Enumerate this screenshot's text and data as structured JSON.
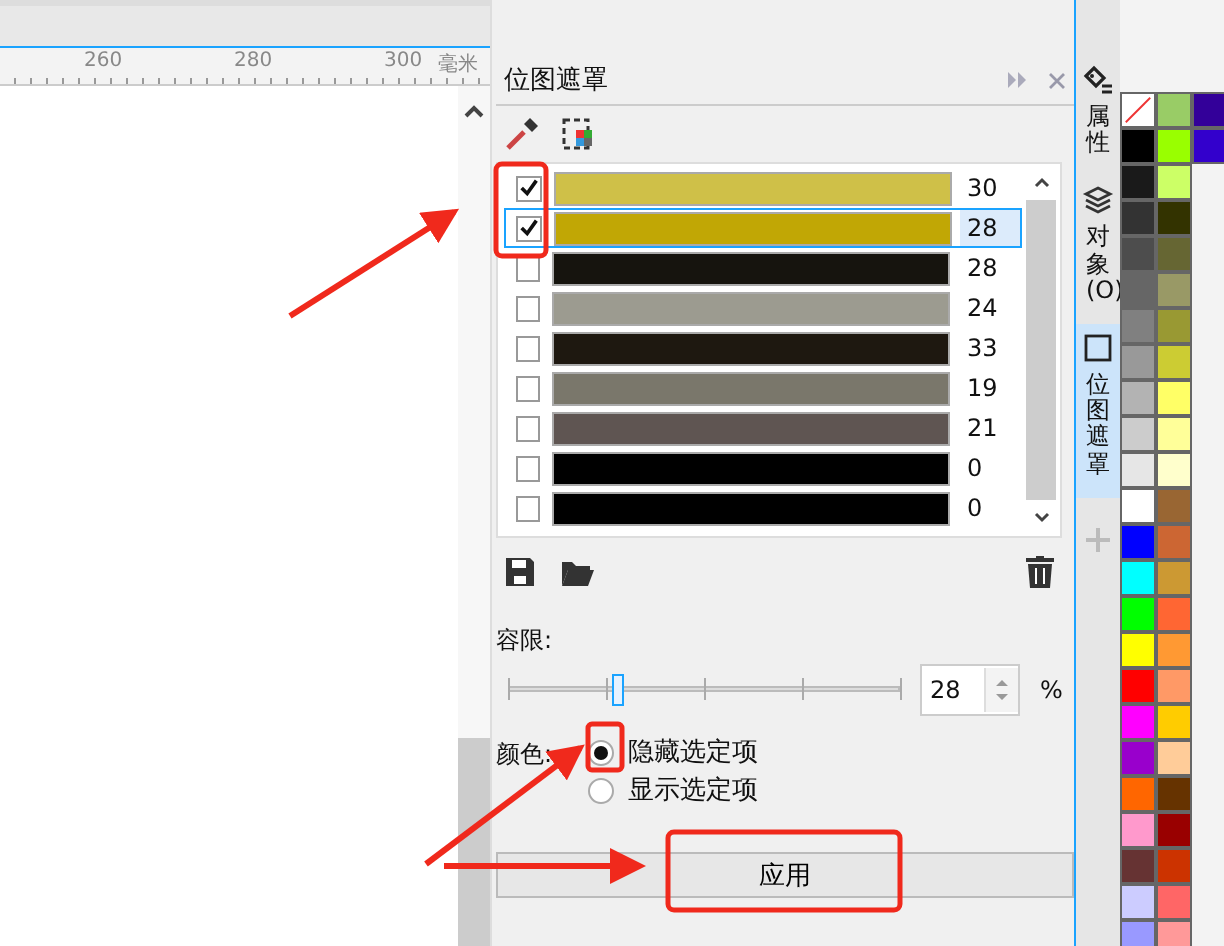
{
  "ruler": {
    "labels": [
      "260",
      "280",
      "300"
    ],
    "unit": "毫米"
  },
  "panel": {
    "title": "位图遮罩",
    "colors": [
      {
        "color": "#cfc048",
        "checked": true,
        "selected": false,
        "value": "30"
      },
      {
        "color": "#c1a705",
        "checked": true,
        "selected": true,
        "value": "28"
      },
      {
        "color": "#16140e",
        "checked": false,
        "selected": false,
        "value": "28"
      },
      {
        "color": "#9c9b90",
        "checked": false,
        "selected": false,
        "value": "24"
      },
      {
        "color": "#1e1810",
        "checked": false,
        "selected": false,
        "value": "33"
      },
      {
        "color": "#7a776b",
        "checked": false,
        "selected": false,
        "value": "19"
      },
      {
        "color": "#5f5552",
        "checked": false,
        "selected": false,
        "value": "21"
      },
      {
        "color": "#000000",
        "checked": false,
        "selected": false,
        "value": "0"
      },
      {
        "color": "#000000",
        "checked": false,
        "selected": false,
        "value": "0"
      }
    ],
    "tolerance": {
      "label": "容限:",
      "level": 0.28,
      "value": "28",
      "unit": "%"
    },
    "color_mode": {
      "label": "颜色:",
      "options": [
        {
          "label": "隐藏选定项",
          "selected": true
        },
        {
          "label": "显示选定项",
          "selected": false
        }
      ]
    },
    "apply_button": "应用"
  },
  "side_tabs": [
    {
      "label": "属性",
      "kind": "properties",
      "selected": false
    },
    {
      "label": "对象(O)",
      "kind": "objects",
      "selected": false
    },
    {
      "label": "位图遮罩",
      "kind": "mask",
      "selected": true
    }
  ],
  "palette": {
    "columns": [
      [
        {
          "kind": "none"
        },
        {
          "color": "#000000"
        },
        {
          "color": "#1a1a1a"
        },
        {
          "color": "#333333"
        },
        {
          "color": "#4d4d4d"
        },
        {
          "color": "#666666"
        },
        {
          "color": "#808080"
        },
        {
          "color": "#999999"
        },
        {
          "color": "#b3b3b3"
        },
        {
          "color": "#cccccc"
        },
        {
          "color": "#e6e6e6"
        },
        {
          "color": "#ffffff"
        },
        {
          "color": "#0000ff"
        },
        {
          "color": "#00ffff"
        },
        {
          "color": "#00ff00"
        },
        {
          "color": "#ffff00"
        },
        {
          "color": "#ff0000"
        },
        {
          "color": "#ff00ff"
        },
        {
          "color": "#9900cc"
        },
        {
          "color": "#ff6600"
        },
        {
          "color": "#ff99cc"
        },
        {
          "color": "#663333"
        },
        {
          "color": "#ccccff"
        },
        {
          "color": "#9999ff"
        }
      ],
      [
        {
          "color": "#99cc66"
        },
        {
          "color": "#99ff00"
        },
        {
          "color": "#ccff66"
        },
        {
          "color": "#333300"
        },
        {
          "color": "#666633"
        },
        {
          "color": "#999966"
        },
        {
          "color": "#999933"
        },
        {
          "color": "#cccc33"
        },
        {
          "color": "#ffff66"
        },
        {
          "color": "#ffff99"
        },
        {
          "color": "#ffffcc"
        },
        {
          "color": "#996633"
        },
        {
          "color": "#cc6633"
        },
        {
          "color": "#cc9933"
        },
        {
          "color": "#ff6633"
        },
        {
          "color": "#ff9933"
        },
        {
          "color": "#ff9966"
        },
        {
          "color": "#ffcc00"
        },
        {
          "color": "#ffcc99"
        },
        {
          "color": "#663300"
        },
        {
          "color": "#990000"
        },
        {
          "color": "#cc3300"
        },
        {
          "color": "#ff6666"
        },
        {
          "color": "#ff9999"
        }
      ],
      [
        {
          "color": "#330099"
        },
        {
          "color": "#3300cc"
        }
      ]
    ]
  }
}
